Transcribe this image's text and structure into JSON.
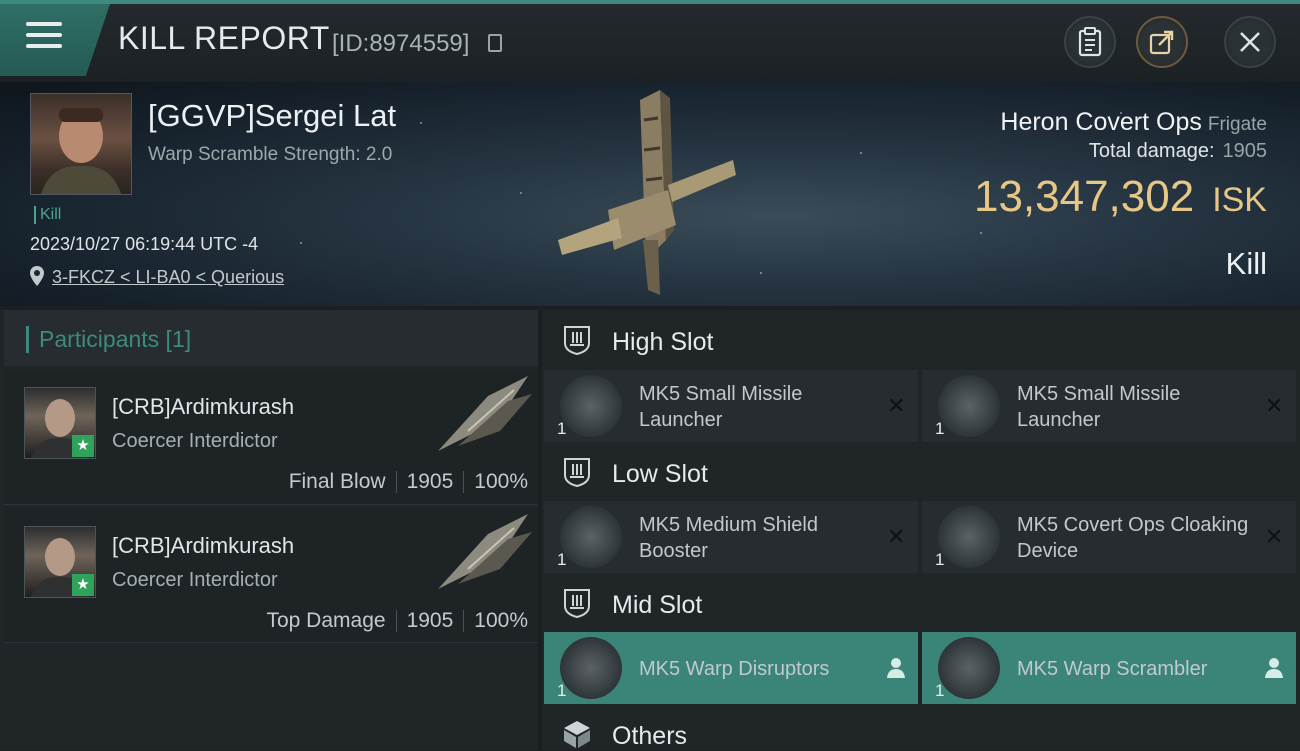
{
  "header": {
    "title": "KILL REPORT",
    "report_id": "[ID:8974559]"
  },
  "victim": {
    "name": "[GGVP]Sergei Lat",
    "warp_scramble": "Warp Scramble Strength: 2.0",
    "tag": "Kill",
    "datetime": "2023/10/27 06:19:44 UTC -4",
    "location": "3-FKCZ < LI-BA0 < Querious"
  },
  "ship": {
    "name": "Heron Covert Ops",
    "class": "Frigate",
    "total_damage_label": "Total damage:",
    "total_damage": "1905",
    "isk_value": "13,347,302",
    "isk_unit": "ISK",
    "result": "Kill"
  },
  "participants": {
    "title": "Participants [1]",
    "rows": [
      {
        "name": "[CRB]Ardimkurash",
        "ship": "Coercer Interdictor",
        "role": "Final Blow",
        "damage": "1905",
        "percent": "100%"
      },
      {
        "name": "[CRB]Ardimkurash",
        "ship": "Coercer Interdictor",
        "role": "Top Damage",
        "damage": "1905",
        "percent": "100%"
      }
    ]
  },
  "slots": {
    "high": {
      "label": "High Slot",
      "modules": [
        {
          "name": "MK5 Small Missile Launcher",
          "qty": "1"
        },
        {
          "name": "MK5 Small Missile Launcher",
          "qty": "1"
        }
      ]
    },
    "low": {
      "label": "Low Slot",
      "modules": [
        {
          "name": "MK5 Medium Shield Booster",
          "qty": "1"
        },
        {
          "name": "MK5 Covert Ops Cloaking Device",
          "qty": "1"
        }
      ]
    },
    "mid": {
      "label": "Mid Slot",
      "modules": [
        {
          "name": "MK5 Warp Disruptors",
          "qty": "1"
        },
        {
          "name": "MK5 Warp Scrambler",
          "qty": "1"
        }
      ]
    },
    "others": {
      "label": "Others"
    }
  },
  "colors": {
    "accent": "#3e8a80",
    "isk": "#e7c786",
    "active_module": "#3a8578",
    "participant_badge": "#2fa35b"
  },
  "icons": [
    "menu-icon",
    "copy-icon",
    "clipboard-icon",
    "share-icon",
    "close-icon",
    "location-pin-icon",
    "high-slot-icon",
    "low-slot-icon",
    "mid-slot-icon",
    "others-cube-icon",
    "remove-x-icon",
    "person-icon",
    "star-badge-icon"
  ]
}
